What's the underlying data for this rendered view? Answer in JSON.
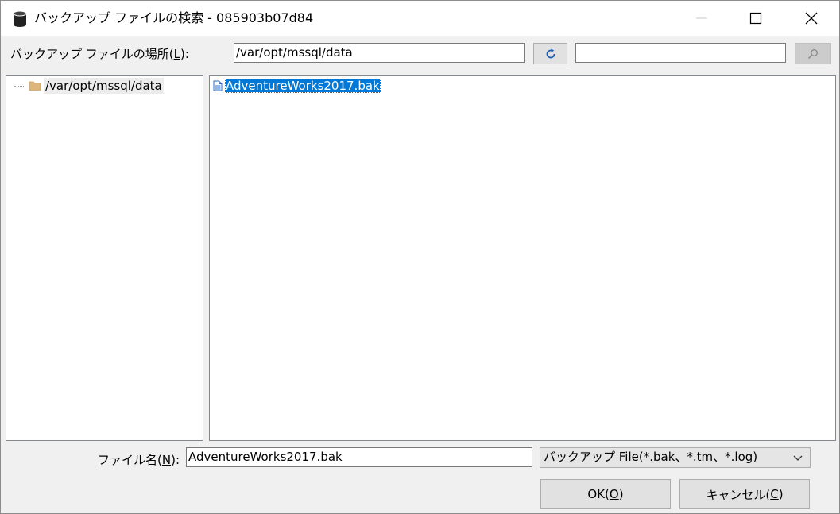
{
  "window": {
    "title": "バックアップ ファイルの検索 - 085903b07d84",
    "icons": {
      "app": "database-icon",
      "minimize": "minimize-icon",
      "maximize": "maximize-icon",
      "close": "close-icon"
    }
  },
  "location": {
    "label_prefix": "バックアップ ファイルの場所(",
    "label_key": "L",
    "label_suffix": "):",
    "path_value": "/var/opt/mssql/data",
    "refresh_icon": "refresh-icon",
    "search_value": "",
    "search_icon": "search-icon"
  },
  "tree": {
    "nodes": [
      {
        "label": "/var/opt/mssql/data",
        "icon": "folder-icon"
      }
    ]
  },
  "files": {
    "items": [
      {
        "name": "AdventureWorks2017.bak",
        "icon": "file-icon",
        "selected": true
      }
    ]
  },
  "filename": {
    "label_prefix": "ファイル名(",
    "label_key": "N",
    "label_suffix": "):",
    "value": "AdventureWorks2017.bak"
  },
  "filetype": {
    "selected": "バックアップ File(*.bak、*.tm、*.log)",
    "icon": "chevron-down-icon"
  },
  "buttons": {
    "ok_prefix": "OK(",
    "ok_key": "O",
    "ok_suffix": ")",
    "cancel_prefix": "キャンセル(",
    "cancel_key": "C",
    "cancel_suffix": ")"
  },
  "colors": {
    "selection": "#0078d7",
    "dialog_bg": "#f0f0f0",
    "button_bg": "#e1e1e1"
  }
}
